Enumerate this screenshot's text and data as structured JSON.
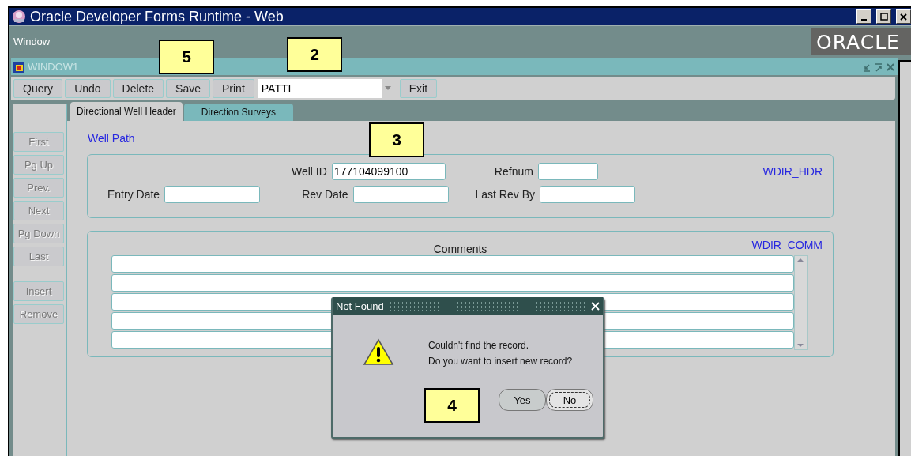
{
  "window": {
    "title": "Oracle Developer Forms Runtime - Web"
  },
  "menu": [
    "Window"
  ],
  "logo": "ORACLE",
  "inner_window": {
    "title": "WINDOW1"
  },
  "toolbar": {
    "buttons_left": [
      "Query",
      "Undo",
      "Delete",
      "Save",
      "Print"
    ],
    "combo": {
      "value": "PATTI"
    },
    "buttons_right": [
      "Exit"
    ]
  },
  "tabs": [
    {
      "label": "Directional Well Header",
      "selected": true
    },
    {
      "label": "Direction Surveys",
      "selected": false
    }
  ],
  "nav_buttons": [
    {
      "label": "First",
      "disabled": true,
      "kind": "nav"
    },
    {
      "label": "Pg Up",
      "disabled": true,
      "kind": "nav"
    },
    {
      "label": "Prev.",
      "disabled": true,
      "kind": "nav"
    },
    {
      "label": "Next",
      "disabled": true,
      "kind": "nav"
    },
    {
      "label": "Pg Down",
      "disabled": true,
      "kind": "nav"
    },
    {
      "label": "Last",
      "disabled": true,
      "kind": "nav"
    },
    {
      "label": "Insert",
      "disabled": true,
      "kind": "edit"
    },
    {
      "label": "Remove",
      "disabled": true,
      "kind": "edit"
    }
  ],
  "section_title": "Well Path",
  "header_block": {
    "tag": "WDIR_HDR",
    "well_id": {
      "label": "Well ID",
      "value": "177104099100"
    },
    "refnum": {
      "label": "Refnum"
    },
    "entry_date": {
      "label": "Entry Date"
    },
    "rev_date": {
      "label": "Rev Date"
    },
    "last_rev_by": {
      "label": "Last Rev By"
    }
  },
  "comments_block": {
    "tag": "WDIR_COMM",
    "label": "Comments"
  },
  "dialog": {
    "title": "Not Found",
    "lines": [
      "Couldn't find the record.",
      "Do you want to insert new record?"
    ],
    "buttons": [
      {
        "label": "Yes",
        "focused": false
      },
      {
        "label": "No",
        "focused": true
      }
    ]
  },
  "callouts": [
    {
      "label": "5",
      "kind": "save"
    },
    {
      "label": "2",
      "kind": "combo"
    },
    {
      "label": "3",
      "kind": "well"
    },
    {
      "label": "4",
      "kind": "dialog"
    }
  ]
}
